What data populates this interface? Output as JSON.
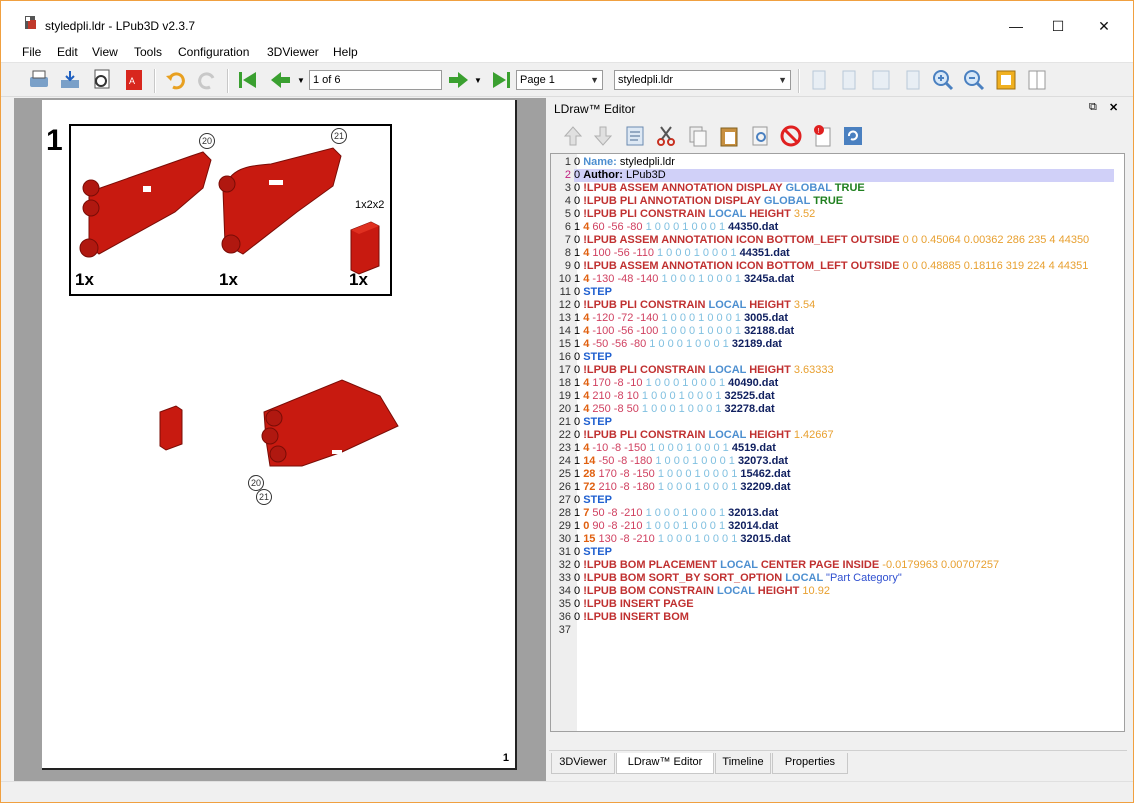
{
  "window": {
    "title": "styledpli.ldr - LPub3D v2.3.7",
    "minimize": "—",
    "maximize": "☐",
    "close": "✕"
  },
  "menu": [
    "File",
    "Edit",
    "View",
    "Tools",
    "Configuration",
    "3DViewer",
    "Help"
  ],
  "toolbar": {
    "page_field": "1 of 6",
    "page_combo": "Page 1",
    "file_combo": "styledpli.ldr"
  },
  "page": {
    "step_number": "1",
    "page_number": "1",
    "pli": {
      "items": [
        {
          "qty": "1x",
          "ref": "20"
        },
        {
          "qty": "1x",
          "ref": "21"
        },
        {
          "qty": "1x",
          "label": "1x2x2"
        }
      ]
    },
    "assembly_refs": [
      "20",
      "21"
    ]
  },
  "dock": {
    "title": "LDraw™ Editor",
    "float_icon": "⧉",
    "close_icon": "✕"
  },
  "tabs": [
    "3DViewer",
    "LDraw™ Editor",
    "Timeline",
    "Properties"
  ],
  "active_tab": "LDraw™ Editor",
  "colors": {
    "meta": "#c03030",
    "keyword_local": "#4d8fd0",
    "number": "#e8a030",
    "pos": "#d04060",
    "matrix": "#80c0e0",
    "part": "#102060",
    "step": "#2060d0",
    "true": "#208020",
    "color_code": "#e06010",
    "name": "#4d8fd0"
  },
  "editor_lines": [
    [
      [
        "0 ",
        "k"
      ],
      [
        "Name: ",
        "name"
      ],
      [
        "styledpli.ldr",
        "k"
      ]
    ],
    [
      [
        "0 ",
        "k"
      ],
      [
        "Author: ",
        "b"
      ],
      [
        "LPub3D",
        "k"
      ]
    ],
    [
      [
        "0 ",
        "k"
      ],
      [
        "!LPUB ",
        "m"
      ],
      [
        "ASSEM ANNOTATION DISPLAY ",
        "m"
      ],
      [
        "GLOBAL ",
        "l"
      ],
      [
        "TRUE",
        "t"
      ]
    ],
    [
      [
        "0 ",
        "k"
      ],
      [
        "!LPUB ",
        "m"
      ],
      [
        "PLI ANNOTATION DISPLAY ",
        "m"
      ],
      [
        "GLOBAL ",
        "l"
      ],
      [
        "TRUE",
        "t"
      ]
    ],
    [
      [
        "0 ",
        "k"
      ],
      [
        "!LPUB ",
        "m"
      ],
      [
        "PLI CONSTRAIN ",
        "m"
      ],
      [
        "LOCAL ",
        "l"
      ],
      [
        "HEIGHT ",
        "m"
      ],
      [
        "3.52",
        "n"
      ]
    ],
    [
      [
        "1 ",
        "k"
      ],
      [
        "4 ",
        "c"
      ],
      [
        "60 -56 -80 ",
        "p"
      ],
      [
        "1 0 0 0 1 0 0 0 1 ",
        "x"
      ],
      [
        "44350.dat",
        "f"
      ]
    ],
    [
      [
        "0 ",
        "k"
      ],
      [
        "!LPUB ",
        "m"
      ],
      [
        "ASSEM ANNOTATION ICON BOTTOM_LEFT OUTSIDE ",
        "m"
      ],
      [
        "0 0 0.45064 0.00362 286 235 4 44350",
        "n"
      ]
    ],
    [
      [
        "1 ",
        "k"
      ],
      [
        "4 ",
        "c"
      ],
      [
        "100 -56 -110 ",
        "p"
      ],
      [
        "1 0 0 0 1 0 0 0 1 ",
        "x"
      ],
      [
        "44351.dat",
        "f"
      ]
    ],
    [
      [
        "0 ",
        "k"
      ],
      [
        "!LPUB ",
        "m"
      ],
      [
        "ASSEM ANNOTATION ICON BOTTOM_LEFT OUTSIDE ",
        "m"
      ],
      [
        "0 0 0.48885 0.18116 319 224 4 44351",
        "n"
      ]
    ],
    [
      [
        "1 ",
        "k"
      ],
      [
        "4 ",
        "c"
      ],
      [
        "-130 -48 -140 ",
        "p"
      ],
      [
        "1 0 0 0 1 0 0 0 1 ",
        "x"
      ],
      [
        "3245a.dat",
        "f"
      ]
    ],
    [
      [
        "0 ",
        "k"
      ],
      [
        "STEP",
        "s"
      ]
    ],
    [
      [
        "0 ",
        "k"
      ],
      [
        "!LPUB ",
        "m"
      ],
      [
        "PLI CONSTRAIN ",
        "m"
      ],
      [
        "LOCAL ",
        "l"
      ],
      [
        "HEIGHT ",
        "m"
      ],
      [
        "3.54",
        "n"
      ]
    ],
    [
      [
        "1 ",
        "k"
      ],
      [
        "4 ",
        "c"
      ],
      [
        "-120 -72 -140 ",
        "p"
      ],
      [
        "1 0 0 0 1 0 0 0 1 ",
        "x"
      ],
      [
        "3005.dat",
        "f"
      ]
    ],
    [
      [
        "1 ",
        "k"
      ],
      [
        "4 ",
        "c"
      ],
      [
        "-100 -56 -100 ",
        "p"
      ],
      [
        "1 0 0 0 1 0 0 0 1 ",
        "x"
      ],
      [
        "32188.dat",
        "f"
      ]
    ],
    [
      [
        "1 ",
        "k"
      ],
      [
        "4 ",
        "c"
      ],
      [
        "-50 -56 -80 ",
        "p"
      ],
      [
        "1 0 0 0 1 0 0 0 1 ",
        "x"
      ],
      [
        "32189.dat",
        "f"
      ]
    ],
    [
      [
        "0 ",
        "k"
      ],
      [
        "STEP",
        "s"
      ]
    ],
    [
      [
        "0 ",
        "k"
      ],
      [
        "!LPUB ",
        "m"
      ],
      [
        "PLI CONSTRAIN ",
        "m"
      ],
      [
        "LOCAL ",
        "l"
      ],
      [
        "HEIGHT ",
        "m"
      ],
      [
        "3.63333",
        "n"
      ]
    ],
    [
      [
        "1 ",
        "k"
      ],
      [
        "4 ",
        "c"
      ],
      [
        "170 -8 -10 ",
        "p"
      ],
      [
        "1 0 0 0 1 0 0 0 1 ",
        "x"
      ],
      [
        "40490.dat",
        "f"
      ]
    ],
    [
      [
        "1 ",
        "k"
      ],
      [
        "4 ",
        "c"
      ],
      [
        "210 -8 10 ",
        "p"
      ],
      [
        "1 0 0 0 1 0 0 0 1 ",
        "x"
      ],
      [
        "32525.dat",
        "f"
      ]
    ],
    [
      [
        "1 ",
        "k"
      ],
      [
        "4 ",
        "c"
      ],
      [
        "250 -8 50 ",
        "p"
      ],
      [
        "1 0 0 0 1 0 0 0 1 ",
        "x"
      ],
      [
        "32278.dat",
        "f"
      ]
    ],
    [
      [
        "0 ",
        "k"
      ],
      [
        "STEP",
        "s"
      ]
    ],
    [
      [
        "0 ",
        "k"
      ],
      [
        "!LPUB ",
        "m"
      ],
      [
        "PLI CONSTRAIN ",
        "m"
      ],
      [
        "LOCAL ",
        "l"
      ],
      [
        "HEIGHT ",
        "m"
      ],
      [
        "1.42667",
        "n"
      ]
    ],
    [
      [
        "1 ",
        "k"
      ],
      [
        "4 ",
        "c"
      ],
      [
        "-10 -8 -150 ",
        "p"
      ],
      [
        "1 0 0 0 1 0 0 0 1 ",
        "x"
      ],
      [
        "4519.dat",
        "f"
      ]
    ],
    [
      [
        "1 ",
        "k"
      ],
      [
        "14 ",
        "c"
      ],
      [
        "-50 -8 -180 ",
        "p"
      ],
      [
        "1 0 0 0 1 0 0 0 1 ",
        "x"
      ],
      [
        "32073.dat",
        "f"
      ]
    ],
    [
      [
        "1 ",
        "k"
      ],
      [
        "28 ",
        "c"
      ],
      [
        "170 -8 -150 ",
        "p"
      ],
      [
        "1 0 0 0 1 0 0 0 1 ",
        "x"
      ],
      [
        "15462.dat",
        "f"
      ]
    ],
    [
      [
        "1 ",
        "k"
      ],
      [
        "72 ",
        "c"
      ],
      [
        "210 -8 -180 ",
        "p"
      ],
      [
        "1 0 0 0 1 0 0 0 1 ",
        "x"
      ],
      [
        "32209.dat",
        "f"
      ]
    ],
    [
      [
        "0 ",
        "k"
      ],
      [
        "STEP",
        "s"
      ]
    ],
    [
      [
        "1 ",
        "k"
      ],
      [
        "7 ",
        "c"
      ],
      [
        "50 -8 -210 ",
        "p"
      ],
      [
        "1 0 0 0 1 0 0 0 1 ",
        "x"
      ],
      [
        "32013.dat",
        "f"
      ]
    ],
    [
      [
        "1 ",
        "k"
      ],
      [
        "0 ",
        "c"
      ],
      [
        "90 -8 -210 ",
        "p"
      ],
      [
        "1 0 0 0 1 0 0 0 1 ",
        "x"
      ],
      [
        "32014.dat",
        "f"
      ]
    ],
    [
      [
        "1 ",
        "k"
      ],
      [
        "15 ",
        "c"
      ],
      [
        "130 -8 -210 ",
        "p"
      ],
      [
        "1 0 0 0 1 0 0 0 1 ",
        "x"
      ],
      [
        "32015.dat",
        "f"
      ]
    ],
    [
      [
        "0 ",
        "k"
      ],
      [
        "STEP",
        "s"
      ]
    ],
    [
      [
        "0 ",
        "k"
      ],
      [
        "!LPUB ",
        "m"
      ],
      [
        "BOM PLACEMENT ",
        "m"
      ],
      [
        "LOCAL ",
        "l"
      ],
      [
        "CENTER PAGE INSIDE ",
        "m"
      ],
      [
        "-0.0179963 0.00707257",
        "n"
      ]
    ],
    [
      [
        "0 ",
        "k"
      ],
      [
        "!LPUB ",
        "m"
      ],
      [
        "BOM SORT_BY SORT_OPTION ",
        "m"
      ],
      [
        "LOCAL ",
        "l"
      ],
      [
        "\"Part Category\"",
        "q"
      ]
    ],
    [
      [
        "0 ",
        "k"
      ],
      [
        "!LPUB ",
        "m"
      ],
      [
        "BOM CONSTRAIN ",
        "m"
      ],
      [
        "LOCAL ",
        "l"
      ],
      [
        "HEIGHT ",
        "m"
      ],
      [
        "10.92",
        "n"
      ]
    ],
    [
      [
        "0 ",
        "k"
      ],
      [
        "!LPUB ",
        "m"
      ],
      [
        "INSERT PAGE",
        "m"
      ]
    ],
    [
      [
        "0 ",
        "k"
      ],
      [
        "!LPUB ",
        "m"
      ],
      [
        "INSERT BOM",
        "m"
      ]
    ],
    []
  ]
}
